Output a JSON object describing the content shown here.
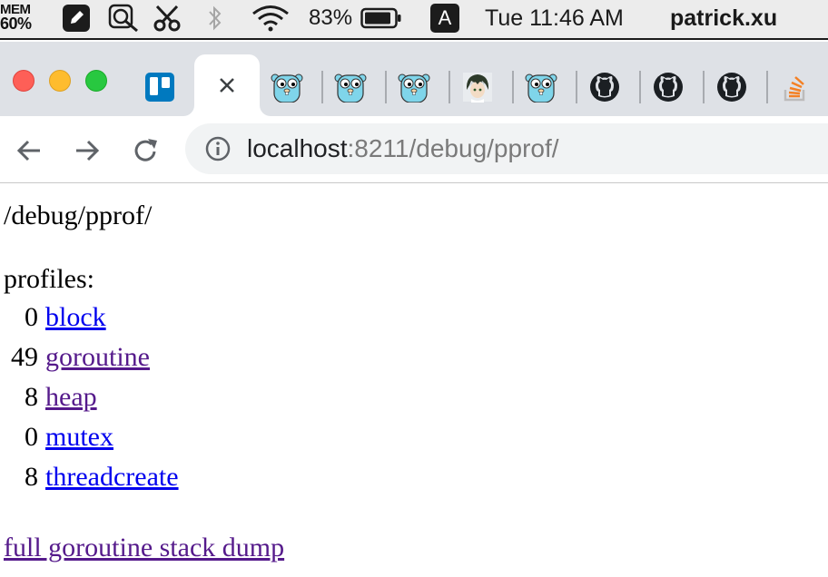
{
  "menubar": {
    "mem_label": "MEM",
    "mem_value": "60%",
    "battery_percent": "83%",
    "input_source": "A",
    "clock": "Tue 11:46 AM",
    "user": "patrick.xu"
  },
  "browser": {
    "tabs": [
      {
        "icon": "trello-icon"
      },
      {
        "icon": "close-icon",
        "active": true
      },
      {
        "icon": "gopher-icon"
      },
      {
        "icon": "gopher-icon"
      },
      {
        "icon": "gopher-icon"
      },
      {
        "icon": "anime-avatar-icon"
      },
      {
        "icon": "gopher-icon"
      },
      {
        "icon": "github-icon"
      },
      {
        "icon": "github-icon"
      },
      {
        "icon": "github-icon"
      },
      {
        "icon": "stackoverflow-icon"
      }
    ],
    "url_host": "localhost",
    "url_rest": ":8211/debug/pprof/"
  },
  "page": {
    "heading": "/debug/pprof/",
    "profiles_label": "profiles:",
    "profiles": [
      {
        "count": "0",
        "name": "block",
        "visited": false
      },
      {
        "count": "49",
        "name": "goroutine",
        "visited": true
      },
      {
        "count": "8",
        "name": "heap",
        "visited": true
      },
      {
        "count": "0",
        "name": "mutex",
        "visited": false
      },
      {
        "count": "8",
        "name": "threadcreate",
        "visited": false
      }
    ],
    "full_dump_link": "full goroutine stack dump"
  },
  "colors": {
    "link_unvisited": "#0000ee",
    "link_visited": "#551a8b",
    "trello": "#0079bf",
    "gopher": "#7fd5ea",
    "stackoverflow": "#f48024"
  }
}
